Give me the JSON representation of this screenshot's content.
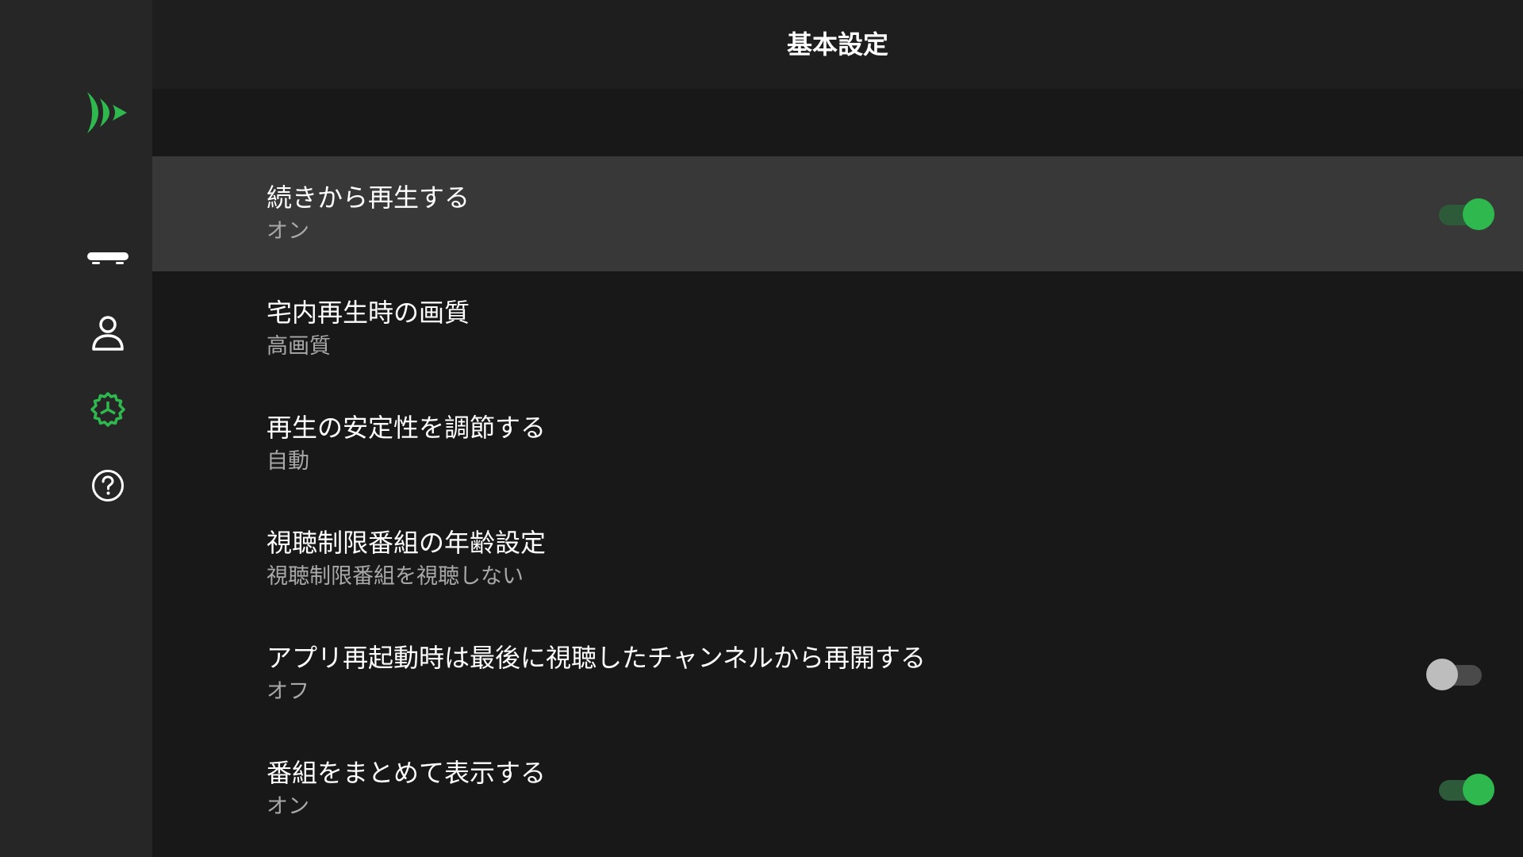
{
  "header": {
    "title": "基本設定"
  },
  "sidebar": {
    "logo": "brand-logo",
    "items": [
      {
        "name": "tv",
        "icon": "tv-icon",
        "active": false
      },
      {
        "name": "account",
        "icon": "person-icon",
        "active": false
      },
      {
        "name": "settings",
        "icon": "gear-icon",
        "active": true
      },
      {
        "name": "help",
        "icon": "help-icon",
        "active": false
      }
    ]
  },
  "settings": [
    {
      "title": "続きから再生する",
      "value": "オン",
      "control": "toggle",
      "state": "on",
      "focused": true
    },
    {
      "title": "宅内再生時の画質",
      "value": "高画質",
      "control": "none",
      "focused": false
    },
    {
      "title": "再生の安定性を調節する",
      "value": "自動",
      "control": "none",
      "focused": false
    },
    {
      "title": "視聴制限番組の年齢設定",
      "value": "視聴制限番組を視聴しない",
      "control": "none",
      "focused": false
    },
    {
      "title": "アプリ再起動時は最後に視聴したチャンネルから再開する",
      "value": "オフ",
      "control": "toggle",
      "state": "off",
      "focused": false
    },
    {
      "title": "番組をまとめて表示する",
      "value": "オン",
      "control": "toggle",
      "state": "on",
      "focused": false
    }
  ],
  "colors": {
    "accent": "#2fb84e",
    "sidebar": "#262626",
    "background": "#181818",
    "focused_row": "#383838",
    "secondary_text": "#a8a8a8"
  }
}
